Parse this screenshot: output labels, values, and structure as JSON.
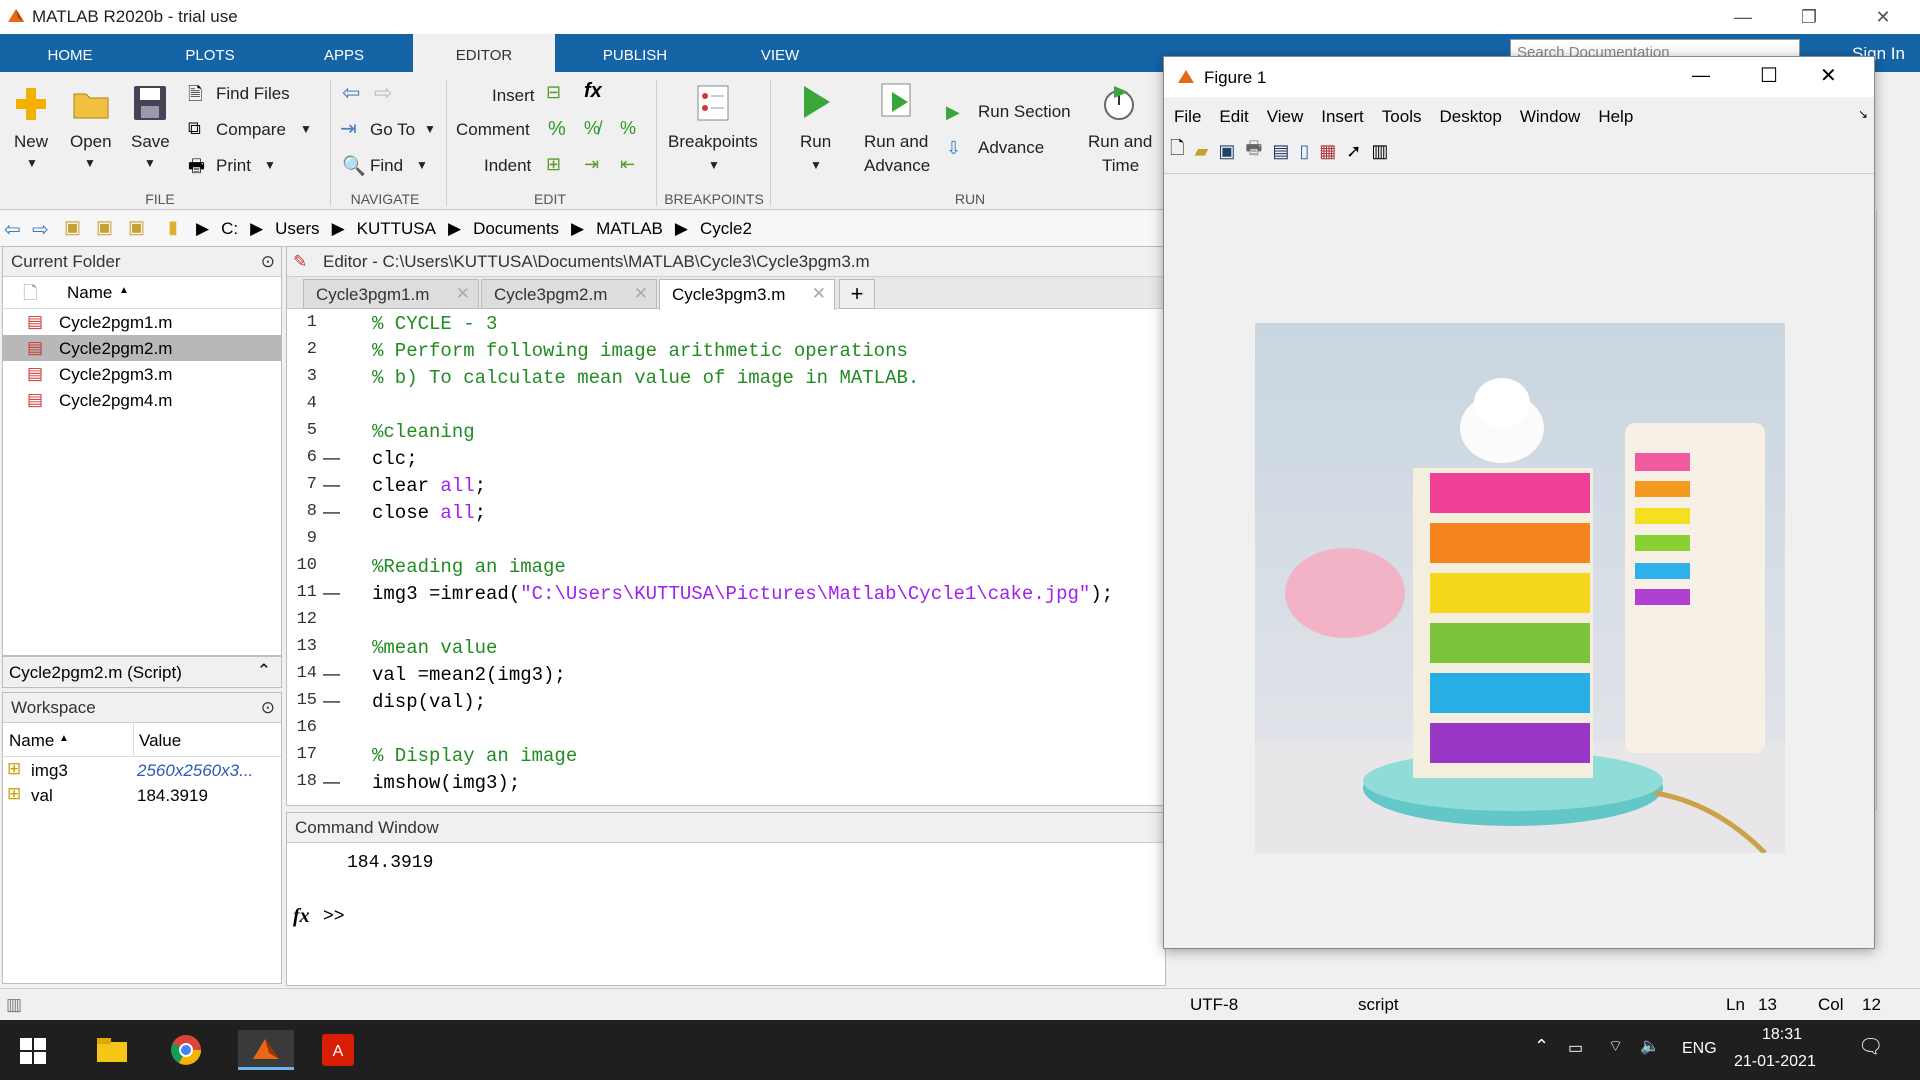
{
  "window": {
    "title": "MATLAB R2020b - trial use"
  },
  "ribbon": {
    "tabs": [
      {
        "label": "HOME"
      },
      {
        "label": "PLOTS"
      },
      {
        "label": "APPS"
      },
      {
        "label": "EDITOR"
      },
      {
        "label": "PUBLISH"
      },
      {
        "label": "VIEW"
      }
    ],
    "search_placeholder": "Search Documentation",
    "sign_in": "Sign In",
    "file": {
      "new": "New",
      "open": "Open",
      "save": "Save",
      "find_files": "Find Files",
      "compare": "Compare",
      "print": "Print",
      "group": "FILE"
    },
    "navigate": {
      "go_to": "Go To",
      "find": "Find",
      "group": "NAVIGATE"
    },
    "edit": {
      "insert": "Insert",
      "comment": "Comment",
      "indent": "Indent",
      "group": "EDIT"
    },
    "breakpoints": {
      "label": "Breakpoints",
      "group": "BREAKPOINTS"
    },
    "run": {
      "run": "Run",
      "run_advance_1": "Run and",
      "run_advance_2": "Advance",
      "run_section": "Run Section",
      "advance": "Advance",
      "run_time_1": "Run and",
      "run_time_2": "Time",
      "group": "RUN"
    }
  },
  "address": {
    "segments": [
      "C:",
      "Users",
      "KUTTUSA",
      "Documents",
      "MATLAB",
      "Cycle2"
    ]
  },
  "current_folder": {
    "title": "Current Folder",
    "col_name": "Name",
    "files": [
      "Cycle2pgm1.m",
      "Cycle2pgm2.m",
      "Cycle2pgm3.m",
      "Cycle2pgm4.m"
    ],
    "details": "Cycle2pgm2.m  (Script)"
  },
  "workspace": {
    "title": "Workspace",
    "col_name": "Name",
    "col_value": "Value",
    "vars": [
      {
        "name": "img3",
        "value": "2560x2560x3..."
      },
      {
        "name": "val",
        "value": "184.3919"
      }
    ]
  },
  "editor": {
    "title": "Editor - C:\\Users\\KUTTUSA\\Documents\\MATLAB\\Cycle3\\Cycle3pgm3.m",
    "tabs": [
      "Cycle3pgm1.m",
      "Cycle3pgm2.m",
      "Cycle3pgm3.m"
    ],
    "lines": [
      {
        "n": "1",
        "parts": [
          {
            "t": "% CYCLE - 3",
            "c": "cmt"
          }
        ]
      },
      {
        "n": "2",
        "parts": [
          {
            "t": "% Perform following image arithmetic operations",
            "c": "cmt"
          }
        ]
      },
      {
        "n": "3",
        "parts": [
          {
            "t": "% b) To calculate mean value of image in MATLAB.",
            "c": "cmt"
          }
        ]
      },
      {
        "n": "4",
        "parts": []
      },
      {
        "n": "5",
        "parts": [
          {
            "t": "%cleaning",
            "c": "cmt"
          }
        ]
      },
      {
        "n": "6",
        "dash": true,
        "parts": [
          {
            "t": "clc;",
            "c": ""
          }
        ]
      },
      {
        "n": "7",
        "dash": true,
        "parts": [
          {
            "t": "clear ",
            "c": ""
          },
          {
            "t": "all",
            "c": "str"
          },
          {
            "t": ";",
            "c": ""
          }
        ]
      },
      {
        "n": "8",
        "dash": true,
        "parts": [
          {
            "t": "close ",
            "c": ""
          },
          {
            "t": "all",
            "c": "str"
          },
          {
            "t": ";",
            "c": ""
          }
        ]
      },
      {
        "n": "9",
        "parts": []
      },
      {
        "n": "10",
        "parts": [
          {
            "t": "%Reading an image",
            "c": "cmt"
          }
        ]
      },
      {
        "n": "11",
        "dash": true,
        "parts": [
          {
            "t": "img3 =imread(",
            "c": ""
          },
          {
            "t": "\"C:\\Users\\KUTTUSA\\Pictures\\Matlab\\Cycle1\\cake.jpg\"",
            "c": "str"
          },
          {
            "t": ");",
            "c": ""
          }
        ]
      },
      {
        "n": "12",
        "parts": []
      },
      {
        "n": "13",
        "parts": [
          {
            "t": "%mean value",
            "c": "cmt"
          }
        ]
      },
      {
        "n": "14",
        "dash": true,
        "parts": [
          {
            "t": "val =mean2(img3);",
            "c": ""
          }
        ]
      },
      {
        "n": "15",
        "dash": true,
        "parts": [
          {
            "t": "disp(val);",
            "c": ""
          }
        ]
      },
      {
        "n": "16",
        "parts": []
      },
      {
        "n": "17",
        "parts": [
          {
            "t": "% Display an image",
            "c": "cmt"
          }
        ]
      },
      {
        "n": "18",
        "dash": true,
        "parts": [
          {
            "t": "imshow(img3);",
            "c": ""
          }
        ]
      }
    ]
  },
  "command": {
    "title": "Command Window",
    "output": "184.3919",
    "prompt": ">>",
    "fx": "fx"
  },
  "figure": {
    "title": "Figure 1",
    "menu": [
      "File",
      "Edit",
      "View",
      "Insert",
      "Tools",
      "Desktop",
      "Window",
      "Help"
    ]
  },
  "status": {
    "encoding": "UTF-8",
    "type": "script",
    "ln_label": "Ln",
    "ln": "13",
    "col_label": "Col",
    "col": "12"
  },
  "taskbar": {
    "lang": "ENG",
    "time": "18:31",
    "date": "21-01-2021"
  }
}
